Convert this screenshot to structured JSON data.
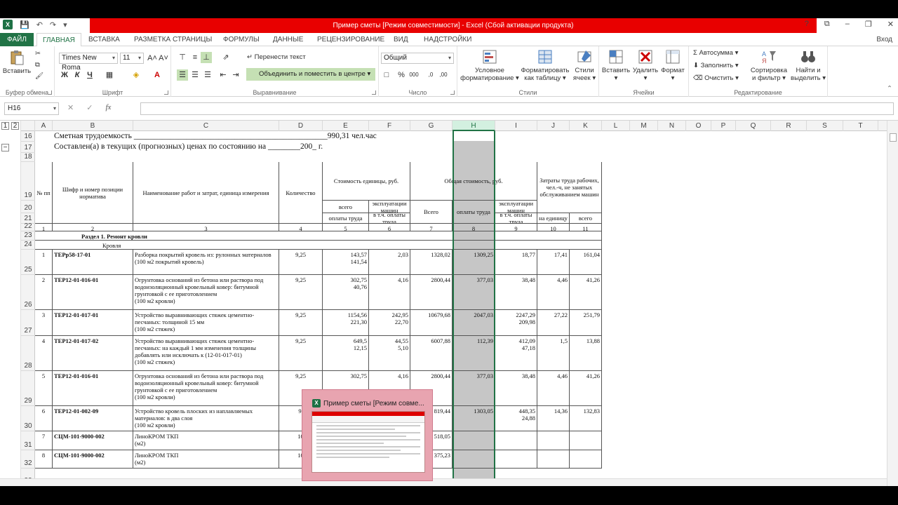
{
  "window": {
    "title": "Пример сметы  [Режим совместимости] - Excel (Сбой активации продукта)",
    "controls": [
      "?",
      "⧉",
      "–",
      "❐",
      "✕"
    ]
  },
  "tabs": {
    "file": "ФАЙЛ",
    "items": [
      "ГЛАВНАЯ",
      "ВСТАВКА",
      "РАЗМЕТКА СТРАНИЦЫ",
      "ФОРМУЛЫ",
      "ДАННЫЕ",
      "РЕЦЕНЗИРОВАНИЕ",
      "ВИД",
      "НАДСТРОЙКИ"
    ],
    "login": "Вход"
  },
  "ribbon": {
    "clipboard": {
      "paste": "Вставить",
      "label": "Буфер обмена"
    },
    "font": {
      "name": "Times New Roma",
      "size": "11",
      "label": "Шрифт",
      "bold": "Ж",
      "italic": "К",
      "underline": "Ч"
    },
    "alignment": {
      "wrap": "Перенести текст",
      "merge": "Объединить и поместить в центре",
      "label": "Выравнивание"
    },
    "number": {
      "format": "Общий",
      "label": "Число"
    },
    "styles": {
      "conditional": "Условное форматирование",
      "as_table": "Форматировать как таблицу",
      "cell_styles": "Стили ячеек",
      "label": "Стили"
    },
    "cells": {
      "insert": "Вставить",
      "delete": "Удалить",
      "format": "Формат",
      "label": "Ячейки"
    },
    "editing": {
      "autosum": "Автосумма",
      "fill": "Заполнить",
      "clear": "Очистить",
      "sort": "Сортировка и фильтр",
      "find": "Найти и выделить",
      "label": "Редактирование"
    }
  },
  "formula_bar": {
    "cell_ref": "H16",
    "value": "",
    "fx": "fx"
  },
  "sheet": {
    "columns": [
      "A",
      "B",
      "C",
      "D",
      "E",
      "F",
      "G",
      "H",
      "I",
      "J",
      "K",
      "L",
      "M",
      "N",
      "O",
      "P",
      "Q",
      "R",
      "S",
      "T"
    ],
    "selected_column": "H",
    "row_numbers": [
      "16",
      "17",
      "18",
      "19",
      "20",
      "21",
      "22",
      "23",
      "24",
      "25",
      "26",
      "27",
      "28",
      "29",
      "30",
      "31",
      "32",
      "33"
    ],
    "line16": "Сметная трудоемкость ________________________________________________990,31 чел.час",
    "line17": "Составлен(а) в текущих (прогнозных) ценах по состоянию на ________200_ г.",
    "headers": {
      "num": "№ пп",
      "code": "Шифр и номер позиции норматива",
      "name": "Наименование работ и затрат, единица измерения",
      "qty": "Количество",
      "unit_cost": "Стоимость единицы, руб.",
      "total_cost": "Общая стоимость, руб.",
      "labor": "Затраты труда рабочих, чел.-ч, не занятых обслуживанием машин",
      "all": "всего",
      "machines": "эксплуатации машин",
      "total": "Всего",
      "wages": "оплаты труда",
      "incl_wages": "в т.ч. оплаты труда",
      "per_unit": "на единицу",
      "total_small": "всего"
    },
    "col_numbers": [
      "1",
      "2",
      "3",
      "4",
      "5",
      "6",
      "7",
      "8",
      "9",
      "10",
      "11"
    ],
    "section": "Раздел 1. Ремонт кровли",
    "subsection": "Кровля",
    "rows": [
      {
        "n": "1",
        "code": "ТЕРр58-17-01",
        "name": "Разборка покрытий кровель из: рулонных материалов\n(100 м2 покрытий кровель)",
        "qty": "9,25",
        "e": "143,57\n141,54",
        "f": "2,03",
        "g": "1328,02",
        "h": "1309,25",
        "i": "18,77",
        "j": "17,41",
        "k": "161,04"
      },
      {
        "n": "2",
        "code": "ТЕР12-01-016-01",
        "name": "Огрунтовка оснований из бетона или раствора под водоизоляционный кровельный ковер: битумной грунтовкой с ее приготовлением\n(100 м2 кровли)",
        "qty": "9,25",
        "e": "302,75\n40,76",
        "f": "4,16",
        "g": "2800,44",
        "h": "377,03",
        "i": "38,48",
        "j": "4,46",
        "k": "41,26"
      },
      {
        "n": "3",
        "code": "ТЕР12-01-017-01",
        "name": "Устройство выравнивающих стяжек цементно-песчаных: толщиной 15 мм\n(100 м2 стяжек)",
        "qty": "9,25",
        "e": "1154,56\n221,30",
        "f": "242,95\n22,70",
        "g": "10679,68",
        "h": "2047,03",
        "i": "2247,29\n209,98",
        "j": "27,22",
        "k": "251,79"
      },
      {
        "n": "4",
        "code": "ТЕР12-01-017-02",
        "name": "Устройство выравнивающих стяжек цементно-песчаных: на каждый 1 мм изменения толщины добавлять или исключать к (12-01-017-01)\n(100 м2 стяжек)",
        "qty": "9,25",
        "e": "649,5\n12,15",
        "f": "44,55\n5,10",
        "g": "6007,88",
        "h": "112,39",
        "i": "412,09\n47,18",
        "j": "1,5",
        "k": "13,88"
      },
      {
        "n": "5",
        "code": "ТЕР12-01-016-01",
        "name": "Огрунтовка оснований из бетона или раствора под водоизоляционный кровельный ковер: битумной грунтовкой с ее приготовлением\n(100 м2 кровли)",
        "qty": "9,25",
        "e": "302,75",
        "f": "4,16",
        "g": "2800,44",
        "h": "377,03",
        "i": "38,48",
        "j": "4,46",
        "k": "41,26"
      },
      {
        "n": "6",
        "code": "ТЕР12-01-002-09",
        "name": "Устройство кровель плоских из наплавляемых материалов: в два слоя\n(100 м2 кровли)",
        "qty": "9,",
        "e": "",
        "f": "",
        "g": "819,44",
        "h": "1303,05",
        "i": "448,35\n24,88",
        "j": "14,36",
        "k": "132,83"
      },
      {
        "n": "7",
        "code": "СЦМ-101-9000-002",
        "name": "ЛиноКРОМ ТКП\n(м2)",
        "qty": "10",
        "e": "",
        "f": "",
        "g": "518,05",
        "h": "",
        "i": "",
        "j": "",
        "k": ""
      },
      {
        "n": "8",
        "code": "СЦМ-101-9000-002",
        "name": "ЛиноКРОМ ТКП\n(м2)",
        "qty": "10",
        "e": "",
        "f": "",
        "g": "375,23",
        "h": "",
        "i": "",
        "j": "",
        "k": ""
      }
    ]
  },
  "taskbar_preview": {
    "title": "Пример сметы  [Режим совме..."
  }
}
